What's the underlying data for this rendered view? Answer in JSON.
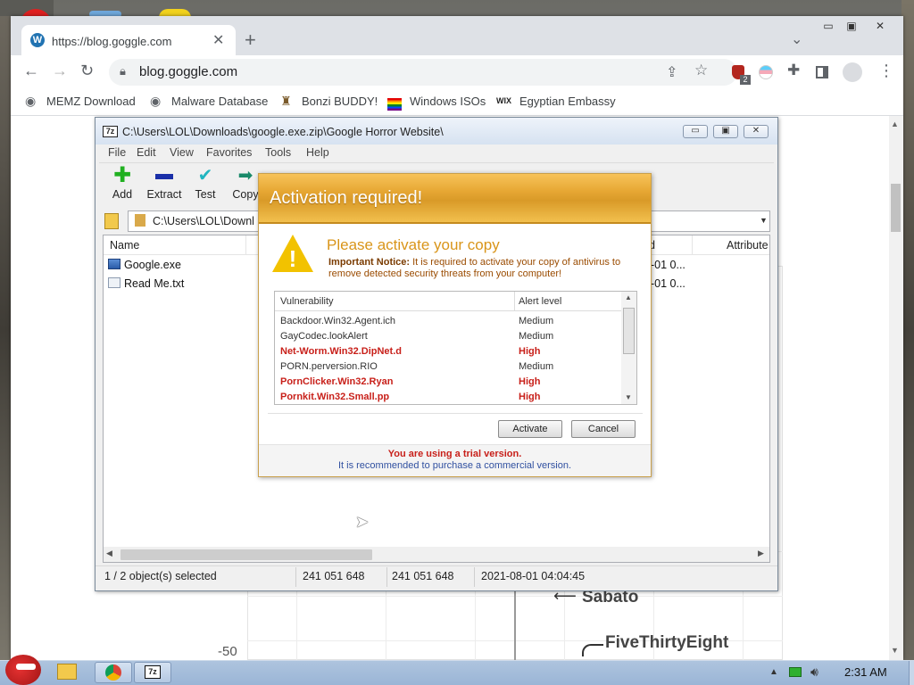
{
  "browser": {
    "tab_title": "https://blog.goggle.com",
    "url": "blog.goggle.com",
    "extension_badge": "2",
    "bookmarks": [
      {
        "label": "MEMZ Download",
        "icon": "globe-icon"
      },
      {
        "label": "Malware Database",
        "icon": "globe-icon"
      },
      {
        "label": "Bonzi BUDDY!",
        "icon": "bonzi-icon"
      },
      {
        "label": "Windows ISOs",
        "icon": "rainbow-flag-icon"
      },
      {
        "label": "Egyptian Embassy",
        "icon": "wix-icon"
      }
    ],
    "bookmark_wix_text": "WIX"
  },
  "page_background": {
    "labels": [
      "Sabato",
      "FiveThirtyEight"
    ],
    "axis_tick": "-50"
  },
  "sevenzip": {
    "title": "C:\\Users\\LOL\\Downloads\\google.exe.zip\\Google Horror Website\\",
    "logo": "7z",
    "menu": [
      "File",
      "Edit",
      "View",
      "Favorites",
      "Tools",
      "Help"
    ],
    "tools": [
      "Add",
      "Extract",
      "Test",
      "Copy"
    ],
    "address": "C:\\Users\\LOL\\Downl",
    "columns": {
      "name": "Name",
      "modified": "d",
      "attributes": "Attribute"
    },
    "files": [
      {
        "name": "Google.exe",
        "modified": "-01 0..."
      },
      {
        "name": "Read Me.txt",
        "modified": "-01 0..."
      }
    ],
    "status": {
      "selected": "1 / 2 object(s) selected",
      "size": "241 051 648",
      "packed": "241 051 648",
      "date": "2021-08-01 04:04:45"
    }
  },
  "dialog": {
    "title": "Activation required!",
    "subtitle": "Please activate your copy",
    "notice_bold": "Important Notice:",
    "notice_text": " It is required to activate your copy of antivirus to remove detected security threats from your computer!",
    "col_vuln": "Vulnerability",
    "col_alert": "Alert level",
    "rows": [
      {
        "name": "Backdoor.Win32.Agent.ich",
        "level": "Medium",
        "high": false
      },
      {
        "name": "GayCodec.lookAlert",
        "level": "Medium",
        "high": false
      },
      {
        "name": "Net-Worm.Win32.DipNet.d",
        "level": "High",
        "high": true
      },
      {
        "name": "PORN.perversion.RIO",
        "level": "Medium",
        "high": false
      },
      {
        "name": "PornClicker.Win32.Ryan",
        "level": "High",
        "high": true
      },
      {
        "name": "Pornkit.Win32.Small.pp",
        "level": "High",
        "high": true
      }
    ],
    "activate_label": "Activate",
    "cancel_label": "Cancel",
    "trial_text": "You are using a trial version.",
    "recommend_text": "It is recommended to purchase a commercial version."
  },
  "taskbar": {
    "clock": "2:31 AM",
    "sevenzip_label": "7z"
  },
  "colors": {
    "dialog_orange": "#e7a834",
    "high_red": "#c8201a",
    "taskbar_blue": "#aec4de"
  }
}
